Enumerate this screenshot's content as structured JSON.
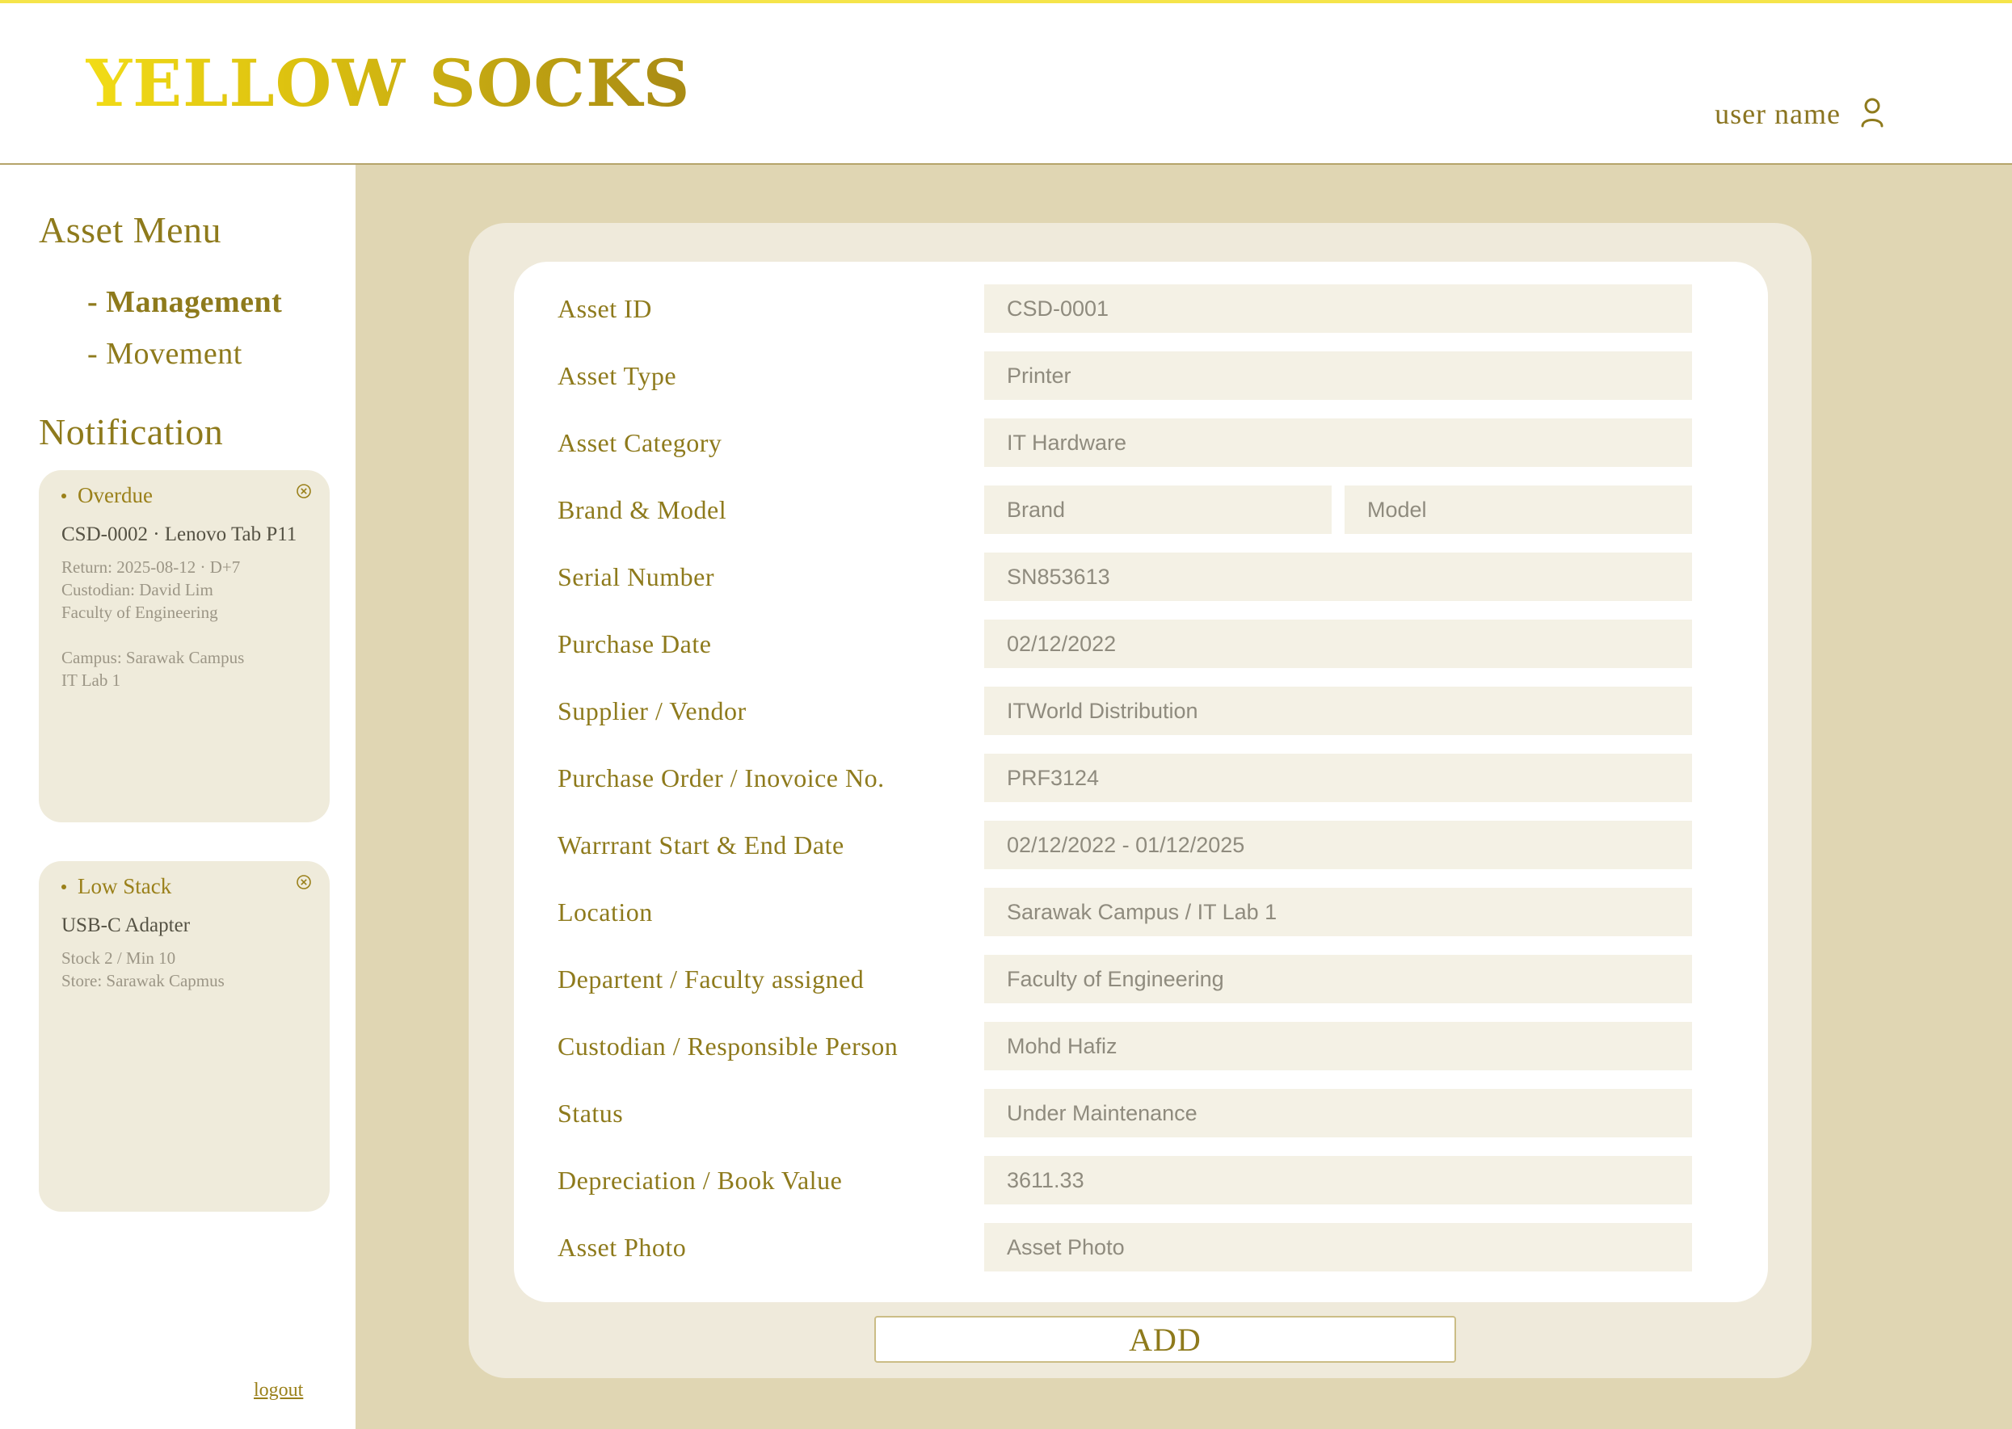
{
  "header": {
    "brand": "YELLOW SOCKS",
    "user_label": "user name"
  },
  "sidebar": {
    "menu_title": "Asset Menu",
    "menu_items": [
      {
        "label": "- Management",
        "active": true
      },
      {
        "label": "- Movement",
        "active": false
      }
    ],
    "notification_title": "Notification",
    "cards": [
      {
        "title": "Overdue",
        "main": "CSD-0002 · Lenovo Tab P11",
        "lines": [
          "Return: 2025-08-12 · D+7",
          "Custodian: David Lim",
          "Faculty of Engineering",
          "",
          "Campus: Sarawak Campus",
          "IT Lab 1"
        ]
      },
      {
        "title": "Low Stack",
        "main": "USB-C Adapter",
        "lines": [
          "Stock 2 / Min 10",
          "Store: Sarawak Capmus"
        ]
      }
    ],
    "logout_label": "logout"
  },
  "form": {
    "fields": [
      {
        "label": "Asset ID",
        "value": "CSD-0001"
      },
      {
        "label": "Asset Type",
        "value": "Printer"
      },
      {
        "label": "Asset Category",
        "value": "IT Hardware"
      },
      {
        "label": "Brand & Model",
        "value": "",
        "placeholder": "Brand",
        "value2": "",
        "placeholder2": "Model"
      },
      {
        "label": "Serial Number",
        "value": "SN853613"
      },
      {
        "label": "Purchase Date",
        "value": "02/12/2022"
      },
      {
        "label": "Supplier / Vendor",
        "value": "ITWorld Distribution"
      },
      {
        "label": "Purchase Order / Inovoice No.",
        "value": "PRF3124"
      },
      {
        "label": "Warrrant Start & End Date",
        "value": "02/12/2022 - 01/12/2025"
      },
      {
        "label": "Location",
        "value": "Sarawak Campus / IT Lab 1"
      },
      {
        "label": "Departent / Faculty assigned",
        "value": "Faculty of Engineering"
      },
      {
        "label": "Custodian / Responsible Person",
        "value": "Mohd Hafiz"
      },
      {
        "label": "Status",
        "value": "Under Maintenance"
      },
      {
        "label": "Depreciation / Book Value",
        "value": "3611.33"
      },
      {
        "label": "Asset Photo",
        "value": "",
        "placeholder": "Asset Photo"
      }
    ],
    "add_label": "ADD"
  },
  "colors": {
    "accent": "#8e7a1c",
    "main_bg": "#e0d6b3",
    "panel_bg": "#efeadb",
    "field_bg": "#f4f1e5"
  },
  "icons": {
    "user": "user-icon",
    "close": "close-circle-icon"
  }
}
